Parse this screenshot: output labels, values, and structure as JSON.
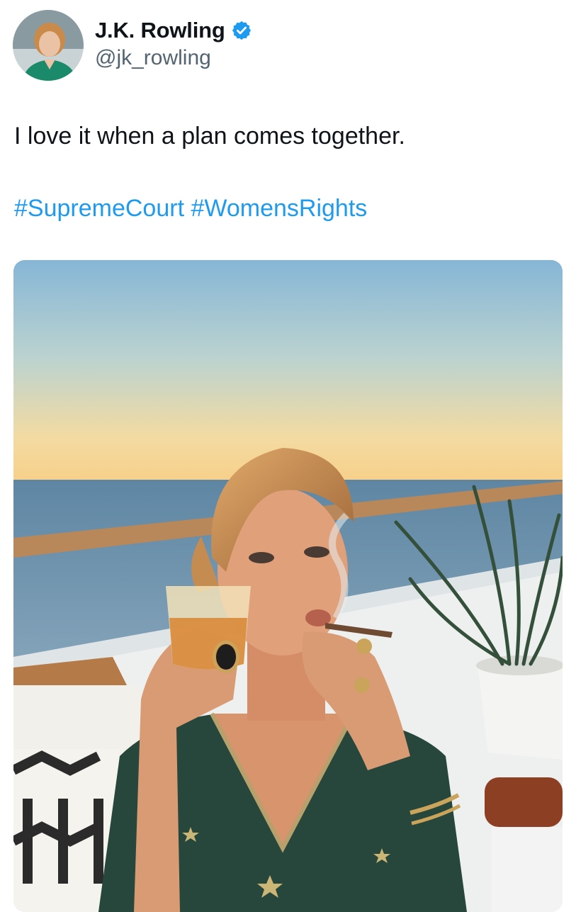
{
  "author": {
    "display_name": "J.K. Rowling",
    "handle": "@jk_rowling",
    "verified": true
  },
  "tweet": {
    "text": "I love it when a plan comes together.",
    "hashtags": [
      "#SupremeCourt",
      "#WomensRights"
    ]
  },
  "colors": {
    "link": "#1d9bf0",
    "verified_badge": "#1d9bf0",
    "handle": "#536471",
    "text": "#0f1419"
  }
}
